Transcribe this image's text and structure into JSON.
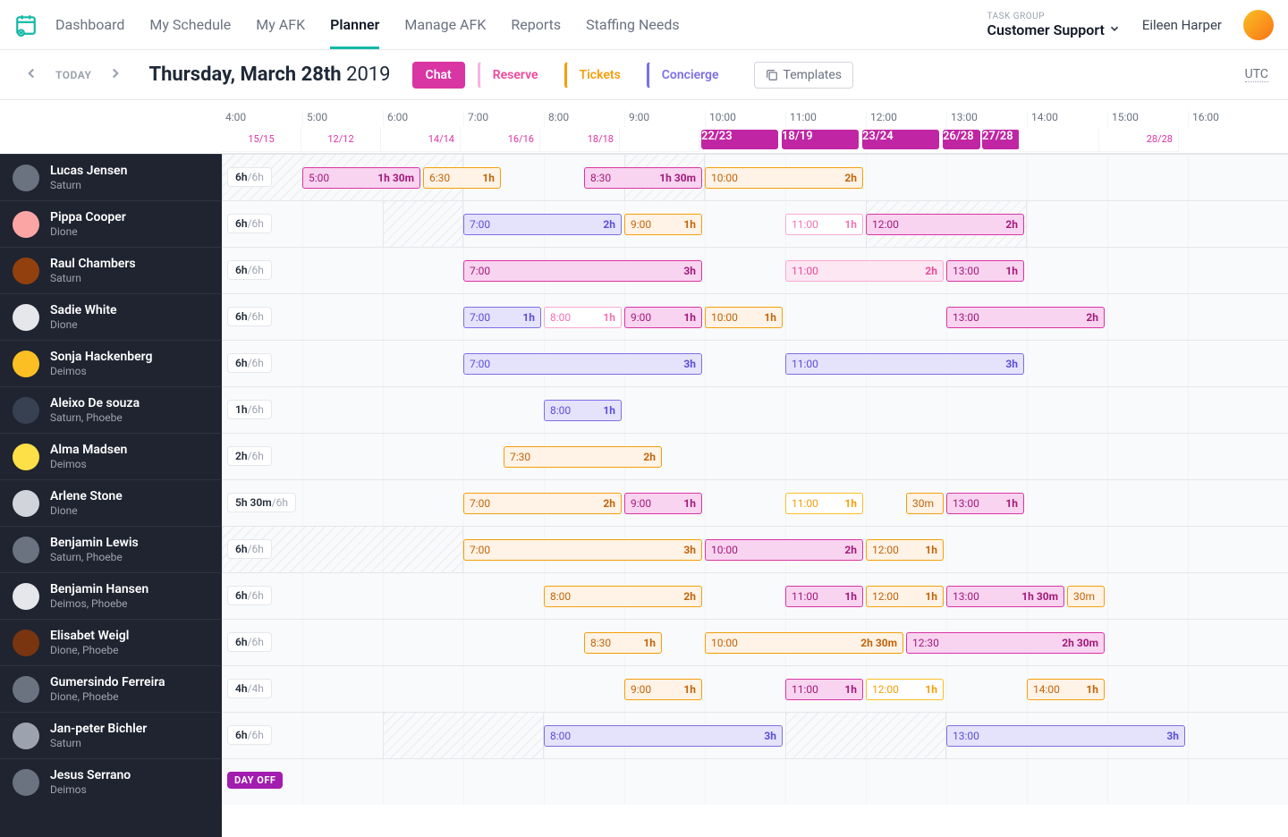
{
  "nav": {
    "items": [
      "Dashboard",
      "My Schedule",
      "My AFK",
      "Planner",
      "Manage AFK",
      "Reports",
      "Staffing Needs"
    ],
    "active_index": 3
  },
  "task_group": {
    "label": "TASK GROUP",
    "value": "Customer Support"
  },
  "user": {
    "name": "Eileen Harper"
  },
  "subbar": {
    "today": "TODAY",
    "date_bold": "Thursday, March 28th",
    "date_year": "2019",
    "chips": {
      "chat": "Chat",
      "reserve": "Reserve",
      "tickets": "Tickets",
      "concierge": "Concierge"
    },
    "templates": "Templates",
    "tz": "UTC"
  },
  "timeline": {
    "hours": [
      "4:00",
      "5:00",
      "6:00",
      "7:00",
      "8:00",
      "9:00",
      "10:00",
      "11:00",
      "12:00",
      "13:00",
      "14:00",
      "15:00",
      "16:00"
    ],
    "caps": [
      {
        "label": "15/15",
        "hot": false,
        "span": 1,
        "align": "center"
      },
      {
        "label": "12/12",
        "hot": false,
        "span": 1
      },
      {
        "label": "14/14",
        "hot": false,
        "span": 1,
        "align": "right"
      },
      {
        "label": "16/16",
        "hot": false,
        "span": 1,
        "align": "right"
      },
      {
        "label": "18/18",
        "hot": false,
        "span": 1,
        "align": "right"
      },
      {
        "label": "",
        "hot": false,
        "span": 1
      },
      {
        "label": "22/23",
        "hot": true,
        "span": 1
      },
      {
        "label": "18/19",
        "hot": true,
        "span": 1
      },
      {
        "label": "23/24",
        "hot": true,
        "span": 1
      },
      {
        "label": "26/28",
        "hot": true,
        "span": 0.5
      },
      {
        "label": "27/28",
        "hot": true,
        "span": 0.5
      },
      {
        "label": "",
        "hot": false,
        "span": 1
      },
      {
        "label": "28/28",
        "hot": false,
        "span": 1,
        "align": "right"
      }
    ]
  },
  "agents": [
    {
      "name": "Lucas Jensen",
      "team": "Saturn",
      "hours": "6h",
      "of": "/6h",
      "avatar": "#6b7280",
      "diag": [
        {
          "start": 4,
          "end": 7
        },
        {
          "start": 9,
          "end": 10
        }
      ],
      "blocks": [
        {
          "start": 5,
          "dur": 1.5,
          "type": "chat",
          "label": "5:00",
          "durLabel": "1h 30m"
        },
        {
          "start": 6.5,
          "dur": 1,
          "type": "tickets",
          "label": "6:30",
          "durLabel": "1h"
        },
        {
          "start": 8.5,
          "dur": 1.5,
          "type": "chat",
          "label": "8:30",
          "durLabel": "1h 30m"
        },
        {
          "start": 10,
          "dur": 2,
          "type": "tickets",
          "label": "10:00",
          "durLabel": "2h"
        }
      ]
    },
    {
      "name": "Pippa Cooper",
      "team": "Dione",
      "hours": "6h",
      "of": "/6h",
      "avatar": "#fca5a5",
      "diag": [
        {
          "start": 6,
          "end": 7
        },
        {
          "start": 12,
          "end": 14
        }
      ],
      "blocks": [
        {
          "start": 7,
          "dur": 2,
          "type": "concierge",
          "label": "7:00",
          "durLabel": "2h"
        },
        {
          "start": 9,
          "dur": 1,
          "type": "tickets",
          "label": "9:00",
          "durLabel": "1h"
        },
        {
          "start": 11,
          "dur": 1,
          "type": "reserve-lt",
          "label": "11:00",
          "durLabel": "1h"
        },
        {
          "start": 12,
          "dur": 2,
          "type": "chat",
          "label": "12:00",
          "durLabel": "2h"
        }
      ]
    },
    {
      "name": "Raul Chambers",
      "team": "Saturn",
      "hours": "6h",
      "of": "/6h",
      "avatar": "#92400e",
      "diag": [],
      "blocks": [
        {
          "start": 7,
          "dur": 3,
          "type": "chat",
          "label": "7:00",
          "durLabel": "3h"
        },
        {
          "start": 11,
          "dur": 2,
          "type": "reserve",
          "label": "11:00",
          "durLabel": "2h"
        },
        {
          "start": 13,
          "dur": 1,
          "type": "chat",
          "label": "13:00",
          "durLabel": "1h"
        }
      ]
    },
    {
      "name": "Sadie White",
      "team": "Dione",
      "hours": "6h",
      "of": "/6h",
      "avatar": "#e5e7eb",
      "diag": [],
      "blocks": [
        {
          "start": 7,
          "dur": 1,
          "type": "concierge",
          "label": "7:00",
          "durLabel": "1h"
        },
        {
          "start": 8,
          "dur": 1,
          "type": "reserve-lt",
          "label": "8:00",
          "durLabel": "1h"
        },
        {
          "start": 9,
          "dur": 1,
          "type": "chat",
          "label": "9:00",
          "durLabel": "1h"
        },
        {
          "start": 10,
          "dur": 1,
          "type": "tickets",
          "label": "10:00",
          "durLabel": "1h"
        },
        {
          "start": 13,
          "dur": 2,
          "type": "chat",
          "label": "13:00",
          "durLabel": "2h"
        }
      ]
    },
    {
      "name": "Sonja Hackenberg",
      "team": "Deimos",
      "hours": "6h",
      "of": "/6h",
      "avatar": "#fbbf24",
      "diag": [],
      "blocks": [
        {
          "start": 7,
          "dur": 3,
          "type": "concierge",
          "label": "7:00",
          "durLabel": "3h"
        },
        {
          "start": 11,
          "dur": 3,
          "type": "concierge",
          "label": "11:00",
          "durLabel": "3h"
        }
      ]
    },
    {
      "name": "Aleixo De souza",
      "team": "Saturn, Phoebe",
      "hours": "1h",
      "of": "/6h",
      "avatar": "#374151",
      "diag": [],
      "blocks": [
        {
          "start": 8,
          "dur": 1,
          "type": "concierge",
          "label": "8:00",
          "durLabel": "1h"
        }
      ]
    },
    {
      "name": "Alma Madsen",
      "team": "Deimos",
      "hours": "2h",
      "of": "/6h",
      "avatar": "#fde047",
      "diag": [],
      "blocks": [
        {
          "start": 7.5,
          "dur": 2,
          "type": "tickets",
          "label": "7:30",
          "durLabel": "2h"
        }
      ]
    },
    {
      "name": "Arlene Stone",
      "team": "Dione",
      "hours": "5h 30m",
      "of": "/6h",
      "avatar": "#d1d5db",
      "diag": [],
      "blocks": [
        {
          "start": 7,
          "dur": 2,
          "type": "tickets",
          "label": "7:00",
          "durLabel": "2h"
        },
        {
          "start": 9,
          "dur": 1,
          "type": "chat",
          "label": "9:00",
          "durLabel": "1h"
        },
        {
          "start": 11,
          "dur": 1,
          "type": "tickets-lt",
          "label": "11:00",
          "durLabel": "1h"
        },
        {
          "start": 12.5,
          "dur": 0.5,
          "type": "tickets",
          "label": "30m",
          "durLabel": ""
        },
        {
          "start": 13,
          "dur": 1,
          "type": "chat",
          "label": "13:00",
          "durLabel": "1h"
        }
      ]
    },
    {
      "name": "Benjamin Lewis",
      "team": "Saturn, Phoebe",
      "hours": "6h",
      "of": "/6h",
      "avatar": "#6b7280",
      "diag": [
        {
          "start": 4,
          "end": 7
        }
      ],
      "blocks": [
        {
          "start": 7,
          "dur": 3,
          "type": "tickets",
          "label": "7:00",
          "durLabel": "3h"
        },
        {
          "start": 10,
          "dur": 2,
          "type": "chat",
          "label": "10:00",
          "durLabel": "2h"
        },
        {
          "start": 12,
          "dur": 1,
          "type": "tickets",
          "label": "12:00",
          "durLabel": "1h"
        }
      ]
    },
    {
      "name": "Benjamin Hansen",
      "team": "Deimos, Phoebe",
      "hours": "6h",
      "of": "/6h",
      "avatar": "#e5e7eb",
      "diag": [],
      "blocks": [
        {
          "start": 8,
          "dur": 2,
          "type": "tickets",
          "label": "8:00",
          "durLabel": "2h"
        },
        {
          "start": 11,
          "dur": 1,
          "type": "chat",
          "label": "11:00",
          "durLabel": "1h"
        },
        {
          "start": 12,
          "dur": 1,
          "type": "tickets",
          "label": "12:00",
          "durLabel": "1h"
        },
        {
          "start": 13,
          "dur": 1.5,
          "type": "chat",
          "label": "13:00",
          "durLabel": "1h 30m"
        },
        {
          "start": 14.5,
          "dur": 0.5,
          "type": "tickets",
          "label": "30m",
          "durLabel": ""
        }
      ]
    },
    {
      "name": "Elisabet Weigl",
      "team": "Dione, Phoebe",
      "hours": "6h",
      "of": "/6h",
      "avatar": "#78350f",
      "diag": [],
      "blocks": [
        {
          "start": 8.5,
          "dur": 1,
          "type": "tickets",
          "label": "8:30",
          "durLabel": "1h"
        },
        {
          "start": 10,
          "dur": 2.5,
          "type": "tickets",
          "label": "10:00",
          "durLabel": "2h 30m"
        },
        {
          "start": 12.5,
          "dur": 2.5,
          "type": "chat",
          "label": "12:30",
          "durLabel": "2h 30m"
        }
      ]
    },
    {
      "name": "Gumersindo Ferreira",
      "team": "Dione, Phoebe",
      "hours": "4h",
      "of": "/4h",
      "avatar": "#6b7280",
      "diag": [],
      "blocks": [
        {
          "start": 9,
          "dur": 1,
          "type": "tickets",
          "label": "9:00",
          "durLabel": "1h"
        },
        {
          "start": 11,
          "dur": 1,
          "type": "chat",
          "label": "11:00",
          "durLabel": "1h"
        },
        {
          "start": 12,
          "dur": 1,
          "type": "tickets-lt",
          "label": "12:00",
          "durLabel": "1h"
        },
        {
          "start": 14,
          "dur": 1,
          "type": "tickets",
          "label": "14:00",
          "durLabel": "1h"
        }
      ]
    },
    {
      "name": "Jan-peter Bichler",
      "team": "Saturn",
      "hours": "6h",
      "of": "/6h",
      "avatar": "#9ca3af",
      "diag": [
        {
          "start": 6,
          "end": 8
        },
        {
          "start": 11,
          "end": 13
        }
      ],
      "blocks": [
        {
          "start": 8,
          "dur": 3,
          "type": "concierge",
          "label": "8:00",
          "durLabel": "3h"
        },
        {
          "start": 13,
          "dur": 3,
          "type": "concierge",
          "label": "13:00",
          "durLabel": "3h"
        }
      ]
    },
    {
      "name": "Jesus Serrano",
      "team": "Deimos",
      "hours": "",
      "of": "",
      "avatar": "#6b7280",
      "dayoff": "DAY OFF",
      "diag": [],
      "blocks": []
    }
  ]
}
